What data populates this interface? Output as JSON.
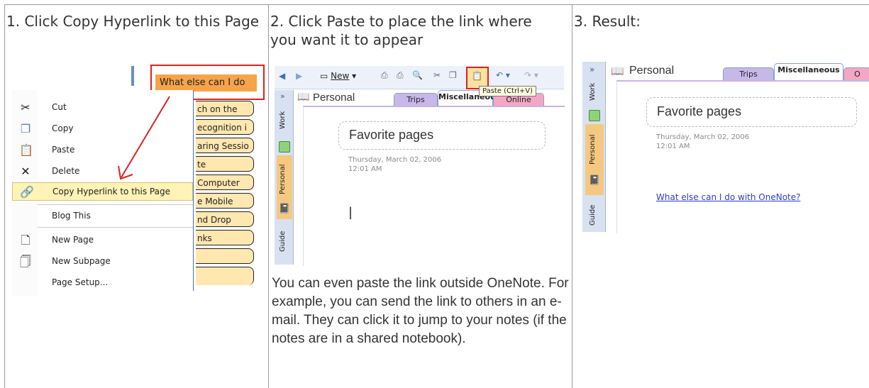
{
  "steps": {
    "step1": "1. Click Copy Hyperlink to this Page",
    "step2": "2. Click Paste to place the link where you want it to appear",
    "step3": "3. Result:"
  },
  "menu": {
    "highlight_tab": "What else can I do",
    "items": [
      {
        "label": "Cut",
        "icon": "scissors-icon"
      },
      {
        "label": "Copy",
        "icon": "copy-icon"
      },
      {
        "label": "Paste",
        "icon": "paste-icon"
      },
      {
        "label": "Delete",
        "icon": "delete-icon"
      },
      {
        "label": "Copy Hyperlink to this Page",
        "icon": "hyperlink-icon"
      },
      {
        "label": "Blog This",
        "icon": ""
      },
      {
        "label": "New Page",
        "icon": "new-page-icon"
      },
      {
        "label": "New Subpage",
        "icon": "new-subpage-icon"
      },
      {
        "label": "Page Setup...",
        "icon": ""
      }
    ],
    "page_tabs": [
      "ch on the",
      "ecognition i",
      "aring Sessio",
      "te",
      "Computer",
      "e Mobile",
      "nd Drop",
      "nks",
      "",
      ""
    ]
  },
  "onenote": {
    "toolbar_new": "New",
    "tooltip": "Paste (Ctrl+V)",
    "notebook": "Personal",
    "sections": [
      "Trips",
      "Miscellaneous",
      "Online"
    ],
    "side_tabs": [
      "Work",
      "Personal",
      "Guide"
    ],
    "chevron": "»",
    "page_title": "Favorite pages",
    "date": "Thursday, March 02, 2006",
    "time": "12:01 AM",
    "cursor": "|"
  },
  "result": {
    "notebook": "Personal",
    "sections": [
      "Trips",
      "Miscellaneous",
      "O"
    ],
    "page_title": "Favorite pages",
    "date": "Thursday, March 02, 2006",
    "time": "12:01 AM",
    "link": "What else can I do with OneNote?"
  },
  "note": "You can even paste the link outside OneNote. For example, you can send the link to others in an e-mail. They can click it to jump to your notes (if the notes are in a shared notebook).",
  "colors": {
    "highlight_red": "#e02020",
    "tab_orange": "#f6a34a",
    "menu_highlight": "#fff3b6",
    "link_blue": "#2b3dc8"
  }
}
